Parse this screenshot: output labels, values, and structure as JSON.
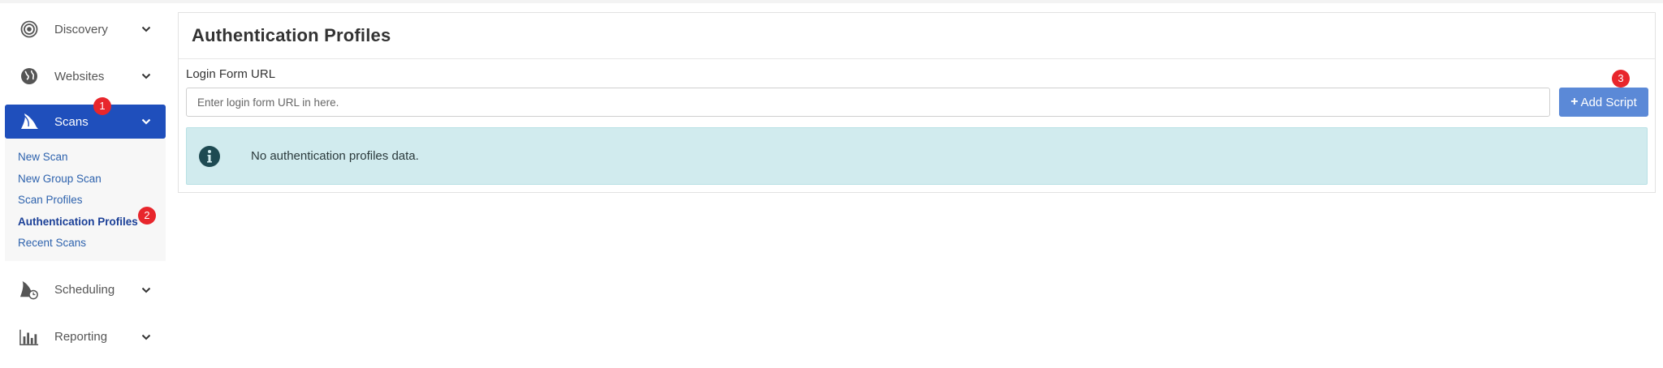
{
  "sidebar": {
    "discovery": {
      "label": "Discovery",
      "icon": "target-icon"
    },
    "websites": {
      "label": "Websites",
      "icon": "globe-icon"
    },
    "scans": {
      "label": "Scans",
      "icon": "shark-fin-icon",
      "badge": "1"
    },
    "scans_sub": {
      "new_scan": "New Scan",
      "new_group_scan": "New Group Scan",
      "scan_profiles": "Scan Profiles",
      "authentication_profiles": "Authentication Profiles",
      "authentication_profiles_badge": "2",
      "recent_scans": "Recent Scans"
    },
    "scheduling": {
      "label": "Scheduling",
      "icon": "shark-fin-clock-icon"
    },
    "reporting": {
      "label": "Reporting",
      "icon": "bar-chart-icon"
    }
  },
  "main": {
    "title": "Authentication Profiles",
    "login_form_label": "Login Form URL",
    "login_form_placeholder": "Enter login form URL in here.",
    "add_script_label": "Add Script",
    "add_script_badge": "3",
    "info_message": "No authentication profiles data."
  },
  "colors": {
    "active_nav": "#1f4fbc",
    "button": "#5b89d7",
    "alert_bg": "#d1ebee",
    "badge": "#e8262c",
    "link": "#2d62ad"
  }
}
